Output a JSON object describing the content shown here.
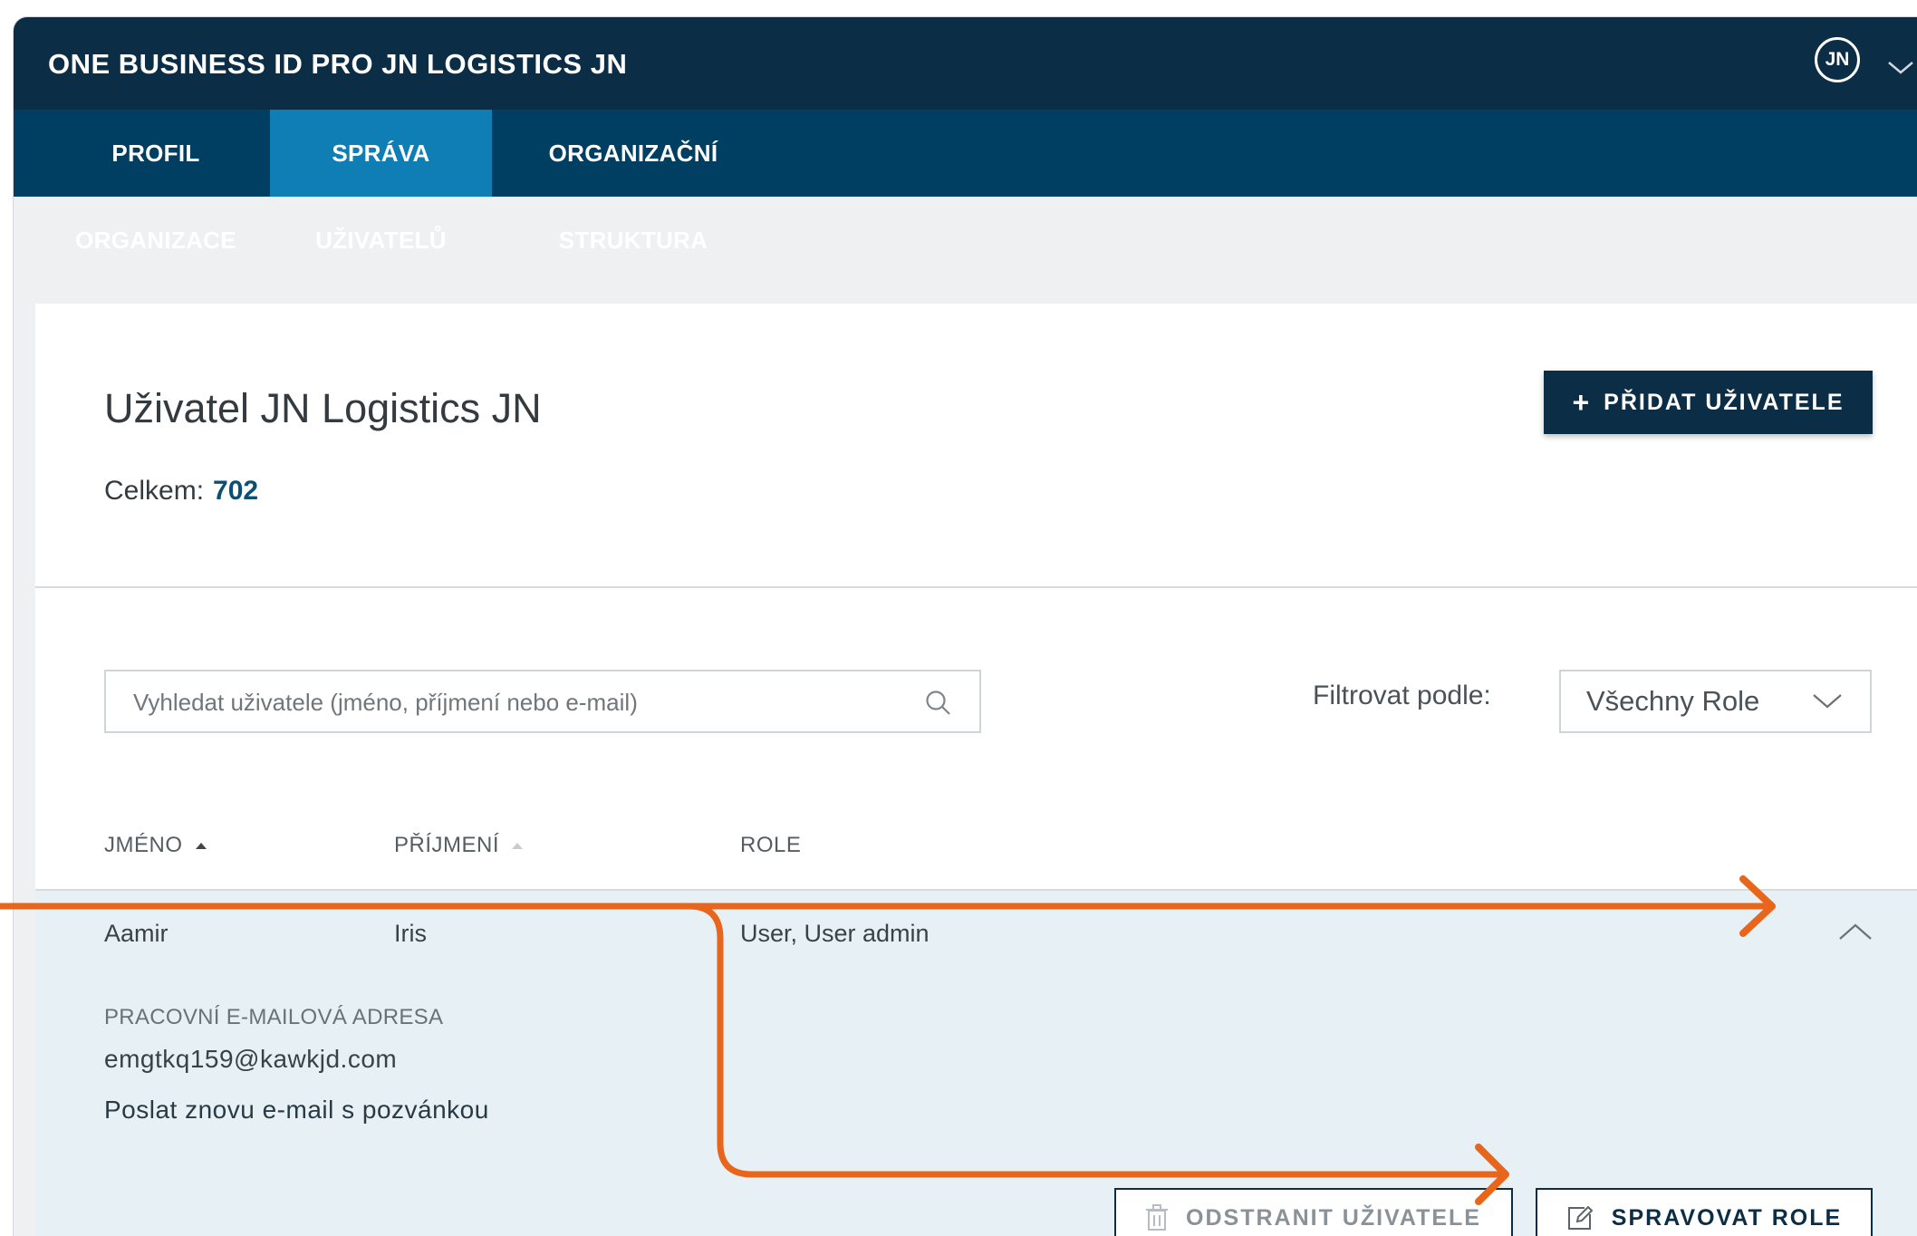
{
  "app": {
    "title": "ONE BUSINESS ID PRO JN LOGISTICS JN",
    "avatar_initials": "JN"
  },
  "tabs": [
    {
      "label": "PROFIL ORGANIZACE",
      "active": false
    },
    {
      "label": "SPRÁVA UŽIVATELŮ",
      "active": true
    },
    {
      "label": "ORGANIZAČNÍ STRUKTURA",
      "active": false
    }
  ],
  "main": {
    "title": "Uživatel JN Logistics JN",
    "total_label": "Celkem:",
    "total_value": "702",
    "add_button_label": "PŘIDAT UŽIVATELE"
  },
  "search": {
    "placeholder": "Vyhledat uživatele (jméno, příjmení nebo e-mail)",
    "value": ""
  },
  "filter": {
    "label": "Filtrovat podle:",
    "selected": "Všechny Role"
  },
  "table": {
    "columns": [
      "JMÉNO",
      "PŘÍJMENÍ",
      "ROLE"
    ],
    "rows": [
      {
        "first_name": "Aamir",
        "last_name": "Iris",
        "role": "User, User admin",
        "expanded": true,
        "details": {
          "email_label": "PRACOVNÍ E-MAILOVÁ ADRESA",
          "email": "emgtkq159@kawkjd.com",
          "resend_link": "Poslat znovu e-mail s pozvánkou",
          "delete_button": "ODSTRANIT UŽIVATELE",
          "manage_roles_button": "SPRAVOVAT ROLE"
        }
      }
    ]
  },
  "colors": {
    "topbar": "#0b2d45",
    "tabbar": "#003e62",
    "active_tab": "#0e7eb5",
    "annotation_arrow": "#e8651c"
  }
}
